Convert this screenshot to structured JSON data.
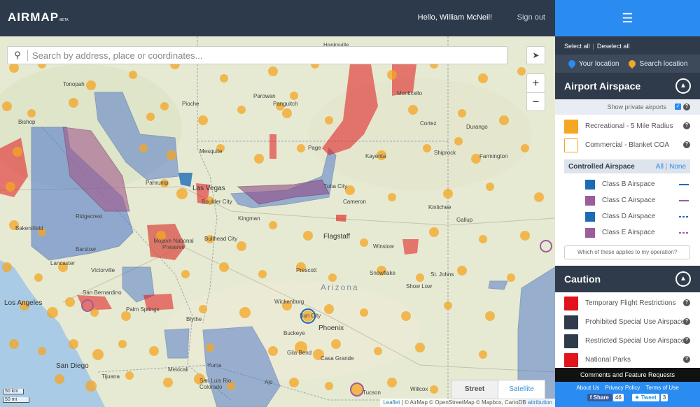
{
  "header": {
    "logo": "AIRMAP",
    "logo_badge": "BETA",
    "greeting": "Hello, William McNeil!",
    "signout": "Sign out"
  },
  "search": {
    "placeholder": "Search by address, place or coordinates..."
  },
  "map_controls": {
    "zoom_in": "+",
    "zoom_out": "−",
    "basemap_street": "Street",
    "basemap_satellite": "Satellite",
    "active_basemap": "Street",
    "scale_km": "50 km",
    "scale_mi": "50 mi"
  },
  "attribution": {
    "leaflet": "Leaflet",
    "text": " | © AirMap © OpenStreetMap © Mapbox, CartoDB ",
    "link": "attribution"
  },
  "map_labels": {
    "tonopah": "Tonopah",
    "bishop": "Bishop",
    "mesquite": "Mesquite",
    "pahrump": "Pahrump",
    "las_vegas": "Las Vegas",
    "boulder_city": "Boulder City",
    "bullhead_city": "Bullhead City",
    "mojave": "Mojave National Preserve",
    "barstow": "Barstow",
    "victorville": "Victorville",
    "lancaster": "Lancaster",
    "bakersfield": "Bakersfield",
    "los_angeles": "Los Angeles",
    "san_bernardino": "San Bernardino",
    "palm_springs": "Palm Springs",
    "san_diego": "San Diego",
    "tijuana": "Tijuana",
    "mexicali": "Mexicali",
    "yuma": "Yuma",
    "san_luis": "San Luis Rio Colorado",
    "ajo": "Ajo",
    "casa_grande": "Casa Grande",
    "tucson": "Tucson",
    "phoenix": "Phoenix",
    "buckeye": "Buckeye",
    "wickenburg": "Wickenburg",
    "blythe": "Blythe",
    "prescott": "Prescott",
    "flagstaff": "Flagstaff",
    "winslow": "Winslow",
    "kayenta": "Kayenta",
    "page": "Page",
    "tuba_city": "Tuba City",
    "cameron": "Cameron",
    "kingman": "Kingman",
    "st_johns": "St. Johns",
    "show_low": "Show Low",
    "snowflake": "Snowflake",
    "gallup": "Gallup",
    "shiprock": "Shiprock",
    "farmington": "Farmington",
    "durango": "Durango",
    "cortez": "Cortez",
    "monticello": "Monticello",
    "hanksville": "Hanksville",
    "parowan": "Parowan",
    "pioche": "Pioche",
    "panguitch": "Panguitch",
    "kinlichee": "Kinlichee",
    "arizona": "Arizona",
    "willcox": "Willcox",
    "los_alamos_sun": "Sun City",
    "ridgecrest": "Ridgecrest",
    "gila_bend": "Gila Bend"
  },
  "panel": {
    "select_all": "Select all",
    "deselect_all": "Deselect all",
    "your_location": "Your location",
    "search_location": "Search location",
    "airport_title": "Airport Airspace",
    "show_private": "Show private airports",
    "recreational": "Recreational - 5 Mile Radius",
    "commercial": "Commercial - Blanket COA",
    "controlled_title": "Controlled Airspace",
    "controlled_all": "All",
    "controlled_none": "None",
    "class_b": "Class B Airspace",
    "class_c": "Class C Airspace",
    "class_d": "Class D Airspace",
    "class_e": "Class E Airspace",
    "which_applies": "Which of these applies to my operation?",
    "caution_title": "Caution",
    "tfr": "Temporary Flight Restrictions",
    "prohibited": "Prohibited Special Use Airspace",
    "restricted": "Restricted Special Use Airspace",
    "national_parks": "National Parks",
    "comments": "Comments and Feature Requests",
    "about": "About Us",
    "privacy": "Privacy Policy",
    "terms": "Terms of Use",
    "fb_share": "Share",
    "fb_count": "46",
    "tweet": "Tweet",
    "tweet_count": "3"
  },
  "colors": {
    "header_bg": "#2c3a4b",
    "accent_blue": "#2a8cf0",
    "recreational": "#f5a623",
    "class_b": "#1d6bb5",
    "class_c": "#9b5d9b",
    "class_d": "#1d6bb5",
    "class_e": "#9b5d9b",
    "tfr": "#e0141a",
    "prohibited": "#2f3b4b",
    "restricted": "#2f3b4b",
    "national_parks": "#e0141a"
  }
}
